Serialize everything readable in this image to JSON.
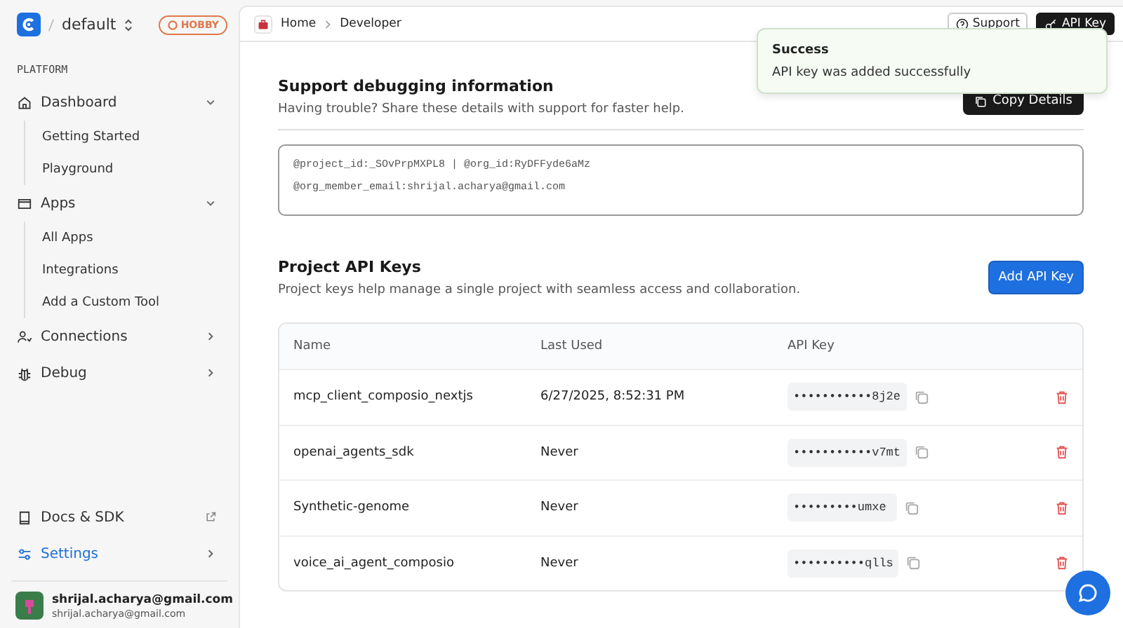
{
  "workspace": {
    "name": "default",
    "plan": "HOBBY"
  },
  "sidebar": {
    "section": "PLATFORM",
    "items": [
      {
        "label": "Dashboard",
        "kind": "group",
        "expanded": true,
        "selected": false,
        "children": [
          {
            "label": "Getting Started"
          },
          {
            "label": "Playground"
          }
        ]
      },
      {
        "label": "Apps",
        "kind": "group",
        "expanded": true,
        "selected": false,
        "children": [
          {
            "label": "All Apps"
          },
          {
            "label": "Integrations"
          },
          {
            "label": "Add a Custom Tool"
          }
        ]
      },
      {
        "label": "Connections",
        "kind": "link",
        "selected": false
      },
      {
        "label": "Debug",
        "kind": "link",
        "selected": false
      }
    ],
    "bottom_items": [
      {
        "label": "Docs & SDK",
        "kind": "external",
        "selected": false
      },
      {
        "label": "Settings",
        "kind": "link",
        "selected": true
      }
    ],
    "user": {
      "name": "shrijal.acharya@gmail.com",
      "email": "shrijal.acharya@gmail.com"
    }
  },
  "breadcrumb": [
    "Home",
    "Developer"
  ],
  "header_buttons": [
    {
      "label": "Support",
      "kind": "outline"
    },
    {
      "label": "API Key",
      "kind": "dark"
    }
  ],
  "toast": {
    "title": "Success",
    "message": "API key was added successfully"
  },
  "debug_section": {
    "title": "Support debugging information",
    "subtitle": "Having trouble? Share these details with support for faster help.",
    "button": "Copy Details",
    "lines": [
      "@project_id:_SOvPrpMXPL8 | @org_id:RyDFFyde6aMz",
      "@org_member_email:shrijal.acharya@gmail.com"
    ]
  },
  "keys_section": {
    "title": "Project API Keys",
    "subtitle": "Project keys help manage a single project with seamless access and collaboration.",
    "button": "Add API Key",
    "columns": [
      "Name",
      "Last Used",
      "API Key"
    ],
    "rows": [
      {
        "name": "mcp_client_composio_nextjs",
        "last_used": "6/27/2025, 8:52:31 PM",
        "key": "•••••••••••8j2e"
      },
      {
        "name": "openai_agents_sdk",
        "last_used": "Never",
        "key": "•••••••••••v7mt"
      },
      {
        "name": "Synthetic-genome",
        "last_used": "Never",
        "key": "•••••••••umxe"
      },
      {
        "name": "voice_ai_agent_composio",
        "last_used": "Never",
        "key": "••••••••••qlls"
      }
    ]
  }
}
